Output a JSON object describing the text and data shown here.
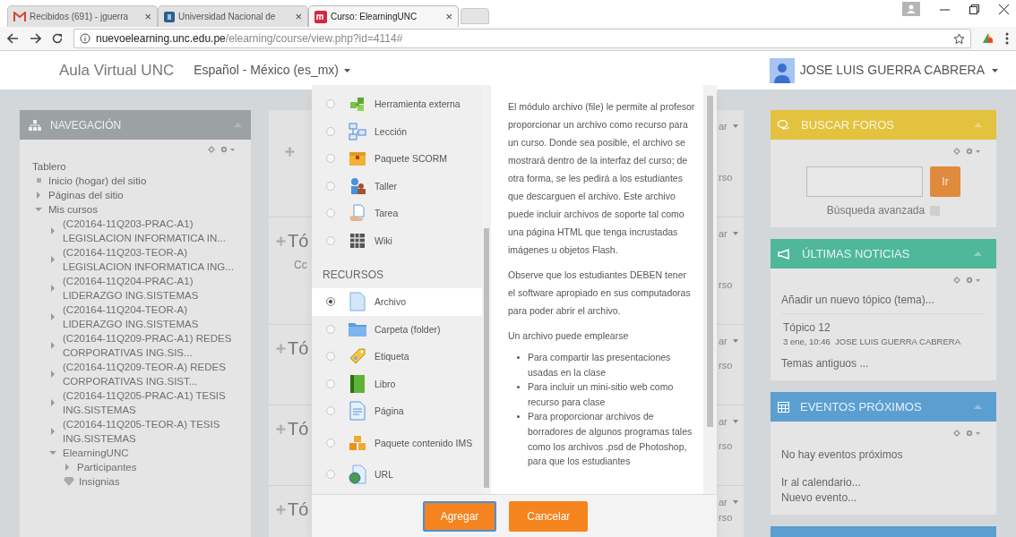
{
  "browser": {
    "tabs": [
      {
        "title": "Recibidos (691) - jguerra",
        "selected": false,
        "kind": "mail"
      },
      {
        "title": "Universidad Nacional de",
        "selected": false,
        "kind": "site"
      },
      {
        "title": "Curso: ElearningUNC",
        "selected": true,
        "kind": "course"
      }
    ],
    "close_glyph": "×",
    "url_host": "nuevoelearning.unc.edu.pe",
    "url_path": "/elearning/course/view.php?id=4114#"
  },
  "header": {
    "site_name": "Aula Virtual UNC",
    "language": "Español - México (es_mx)",
    "user_name": "JOSE LUIS GUERRA CABRERA"
  },
  "navigation": {
    "title": "NAVEGACIÓN",
    "tree": [
      {
        "label": "Tablero",
        "children": [
          {
            "label": "Inicio (hogar) del sitio",
            "kind": "leaf"
          },
          {
            "label": "Páginas del sitio",
            "kind": "branch",
            "expanded": false
          },
          {
            "label": "Mis cursos",
            "kind": "branch",
            "expanded": true,
            "children": [
              {
                "label": "(C20164-11Q203-PRAC-A1) LEGISLACION INFORMATICA IN...",
                "kind": "branch",
                "expanded": false
              },
              {
                "label": "(C20164-11Q203-TEOR-A) LEGISLACION INFORMATICA ING...",
                "kind": "branch",
                "expanded": false
              },
              {
                "label": "(C20164-11Q204-PRAC-A1) LIDERAZGO ING.SISTEMAS",
                "kind": "branch",
                "expanded": false
              },
              {
                "label": "(C20164-11Q204-TEOR-A) LIDERAZGO ING.SISTEMAS",
                "kind": "branch",
                "expanded": false
              },
              {
                "label": "(C20164-11Q209-PRAC-A1) REDES CORPORATIVAS ING.SIS...",
                "kind": "branch",
                "expanded": false
              },
              {
                "label": "(C20164-11Q209-TEOR-A) REDES CORPORATIVAS ING.SIST...",
                "kind": "branch",
                "expanded": false
              },
              {
                "label": "(C20164-11Q205-PRAC-A1) TESIS ING.SISTEMAS",
                "kind": "branch",
                "expanded": false
              },
              {
                "label": "(C20164-11Q205-TEOR-A) TESIS ING.SISTEMAS",
                "kind": "branch",
                "expanded": false
              },
              {
                "label": "ElearningUNC",
                "kind": "branch",
                "expanded": true,
                "children": [
                  {
                    "label": "Participantes",
                    "kind": "branch",
                    "expanded": false
                  },
                  {
                    "label": "Insignias",
                    "kind": "badges"
                  }
                ]
              }
            ]
          }
        ]
      }
    ]
  },
  "course_sections": [
    {
      "edit": "ar",
      "edit_bottom": "rso"
    },
    {
      "title": "Tó",
      "summary": "Cc",
      "edit": "ar",
      "edit_bottom": "rso"
    },
    {
      "title": "Tó",
      "edit": "ar",
      "edit_bottom": "rso"
    },
    {
      "title": "Tó",
      "edit": "ar",
      "edit_bottom": "rso"
    },
    {
      "title": "Tó",
      "edit": "ar",
      "edit_bottom": "rso"
    }
  ],
  "chooser": {
    "options": [
      {
        "kind": "option",
        "label": "Herramienta externa",
        "selected": false
      },
      {
        "kind": "option",
        "label": "Lección",
        "selected": false
      },
      {
        "kind": "option",
        "label": "Paquete SCORM",
        "selected": false
      },
      {
        "kind": "option",
        "label": "Taller",
        "selected": false
      },
      {
        "kind": "option",
        "label": "Tarea",
        "selected": false
      },
      {
        "kind": "option",
        "label": "Wiki",
        "selected": false
      },
      {
        "kind": "heading",
        "label": "RECURSOS"
      },
      {
        "kind": "option",
        "label": "Archivo",
        "selected": true
      },
      {
        "kind": "option",
        "label": "Carpeta (folder)",
        "selected": false
      },
      {
        "kind": "option",
        "label": "Etiqueta",
        "selected": false
      },
      {
        "kind": "option",
        "label": "Libro",
        "selected": false
      },
      {
        "kind": "option",
        "label": "Página",
        "selected": false
      },
      {
        "kind": "option",
        "label": "Paquete contenido IMS",
        "selected": false
      },
      {
        "kind": "option",
        "label": "URL",
        "selected": false
      }
    ],
    "description": {
      "paragraphs": [
        "El módulo archivo (file) le permite al profesor proporcionar un archivo como recurso para un curso. Donde sea posible, el archivo se mostrará dentro de la interfaz del curso; de otra forma, se les pedirá a los estudiantes que descarguen el archivo. Este archivo puede incluir archivos de soporte tal como una página HTML que tenga incrustadas imágenes u objetos Flash.",
        "Observe que los estudiantes DEBEN tener el software apropiado en sus computadoras para poder abrir el archivo.",
        "Un archivo puede emplearse"
      ],
      "bullets": [
        "Para compartir las presentaciones usadas en la clase",
        "Para incluir un mini-sitio web como recurso para clase",
        "Para proporcionar archivos de borradores de algunos programas tales como los archivos .psd de Photoshop, para que los estudiantes"
      ]
    },
    "buttons": [
      {
        "label": "Agregar",
        "focused": true
      },
      {
        "label": "Cancelar",
        "focused": false
      }
    ]
  },
  "blocks": [
    {
      "kind": "search",
      "title": "BUSCAR FOROS",
      "color": "#e3c23e",
      "button": "Ir",
      "link": "Búsqueda avanzada"
    },
    {
      "kind": "news",
      "title": "ÚLTIMAS NOTICIAS",
      "color": "#4fb89b",
      "add_link": "Añadir un nuevo tópico (tema)...",
      "post_title": "Tópico 12",
      "post_meta": "3 ene, 10:46  JOSE LUIS GUERRA CABRERA",
      "older_link": "Temas antiguos ..."
    },
    {
      "kind": "events",
      "title": "EVENTOS PRÓXIMOS",
      "color": "#5b9fd1",
      "empty_text": "No hay eventos próximos",
      "links": [
        "Ir al calendario...",
        "Nuevo evento..."
      ]
    }
  ]
}
